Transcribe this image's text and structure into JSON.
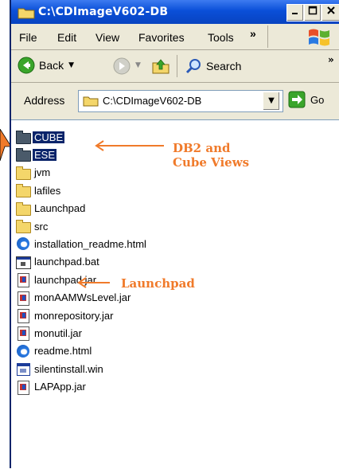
{
  "window": {
    "title": "C:\\CDImageV602-DB",
    "controls": [
      "minimize",
      "maximize",
      "close"
    ]
  },
  "menu": {
    "items": [
      {
        "label": "File",
        "underline": "F"
      },
      {
        "label": "Edit",
        "underline": "E"
      },
      {
        "label": "View",
        "underline": "V"
      },
      {
        "label": "Favorites",
        "underline": "a"
      },
      {
        "label": "Tools",
        "underline": "T"
      }
    ],
    "overflow": "»"
  },
  "toolbar": {
    "back_label": "Back",
    "search_label": "Search",
    "overflow": "»"
  },
  "address": {
    "label": "Address",
    "value": "C:\\CDImageV602-DB",
    "go_label": "Go"
  },
  "files": [
    {
      "name": "CUBE",
      "type": "folder-dark",
      "selected": true
    },
    {
      "name": "ESE",
      "type": "folder-dark",
      "selected": true
    },
    {
      "name": "jvm",
      "type": "folder"
    },
    {
      "name": "lafiles",
      "type": "folder"
    },
    {
      "name": "Launchpad",
      "type": "folder"
    },
    {
      "name": "src",
      "type": "folder"
    },
    {
      "name": "installation_readme.html",
      "type": "html"
    },
    {
      "name": "launchpad.bat",
      "type": "bat"
    },
    {
      "name": "launchpad.jar",
      "type": "jar"
    },
    {
      "name": "monAAMWsLevel.jar",
      "type": "jar"
    },
    {
      "name": "monrepository.jar",
      "type": "jar"
    },
    {
      "name": "monutil.jar",
      "type": "jar"
    },
    {
      "name": "readme.html",
      "type": "html"
    },
    {
      "name": "silentinstall.win",
      "type": "win"
    },
    {
      "name": "LAPApp.jar",
      "type": "jar"
    }
  ],
  "annotations": {
    "db2_line1": "DB2 and",
    "db2_line2": "Cube Views",
    "launchpad": "Launchpad"
  },
  "colors": {
    "titlebar": "#0a4fd8",
    "selection": "#0a246a",
    "annotation": "#f07a2a",
    "chrome": "#ece9d8"
  }
}
